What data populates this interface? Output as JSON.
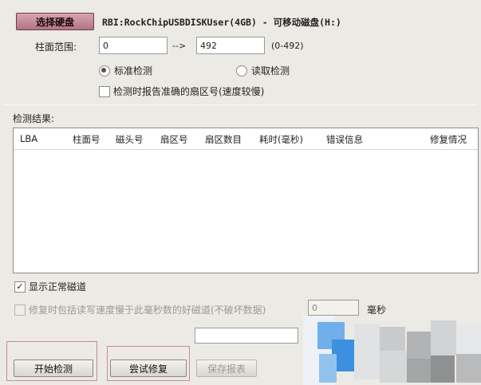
{
  "disk": {
    "select_button": "选择硬盘",
    "description": "RBI:RockChipUSBDISKUser(4GB) - 可移动磁盘(H:)"
  },
  "cylinder_range": {
    "label": "柱面范围:",
    "start": "0",
    "arrow": "-->",
    "end": "492",
    "hint": "(0-492)"
  },
  "mode": {
    "standard": "标准检测",
    "read": "读取检测",
    "selected": "standard"
  },
  "accurate_sector_option": "检测时报告准确的扇区号(速度较慢)",
  "results": {
    "label": "检测结果:",
    "columns": [
      "LBA",
      "柱面号",
      "磁头号",
      "扇区号",
      "扇区数目",
      "耗时(毫秒)",
      "错误信息",
      "修复情况"
    ]
  },
  "show_normal": {
    "label": "显示正常磁道",
    "checked": true
  },
  "repair_option": {
    "label": "修复时包括读写速度慢于此毫秒数的好磁道(不破坏数据)",
    "value": "0",
    "unit": "毫秒"
  },
  "buttons": {
    "start": "开始检测",
    "try_repair": "尝试修复",
    "save_report": "保存报表"
  },
  "colors": {
    "select_button": "#b27386",
    "highlight_frame": "#c98b99"
  }
}
